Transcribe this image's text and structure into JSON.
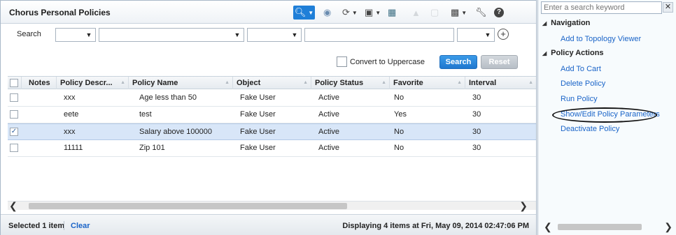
{
  "panel": {
    "title": "Chorus Personal Policies"
  },
  "toolbar": {
    "icons": [
      "search-icon",
      "globe-icon",
      "refresh-icon",
      "save-icon",
      "find-icon",
      "export-icon",
      "settings-wrench-icon",
      "help-icon"
    ]
  },
  "search": {
    "label": "Search",
    "convert_label": "Convert to Uppercase",
    "search_button": "Search",
    "reset_button": "Reset"
  },
  "table": {
    "columns": [
      "Notes",
      "Policy Descr...",
      "Policy Name",
      "Object",
      "Policy Status",
      "Favorite",
      "Interval"
    ],
    "rows": [
      {
        "checked": false,
        "notes": "",
        "descr": "xxx",
        "name": "Age less than 50",
        "object": "Fake User",
        "status": "Active",
        "favorite": "No",
        "interval": "30"
      },
      {
        "checked": false,
        "notes": "",
        "descr": "eete",
        "name": "test",
        "object": "Fake User",
        "status": "Active",
        "favorite": "Yes",
        "interval": "30"
      },
      {
        "checked": true,
        "notes": "",
        "descr": "xxx",
        "name": "Salary above 100000",
        "object": "Fake User",
        "status": "Active",
        "favorite": "No",
        "interval": "30"
      },
      {
        "checked": false,
        "notes": "",
        "descr": "11111",
        "name": "Zip 101",
        "object": "Fake User",
        "status": "Active",
        "favorite": "No",
        "interval": "30"
      }
    ]
  },
  "footer": {
    "selected": "Selected 1 item",
    "clear": "Clear",
    "display": "Displaying 4 items at Fri, May 09, 2014 02:47:06 PM"
  },
  "side": {
    "search_placeholder": "Enter a search keyword",
    "navigation_title": "Navigation",
    "navigation_items": [
      "Add to Topology Viewer"
    ],
    "actions_title": "Policy Actions",
    "action_items": [
      "Add To Cart",
      "Delete Policy",
      "Run Policy",
      "Show/Edit Policy Parameters",
      "Deactivate Policy"
    ]
  },
  "colors": {
    "accent": "#1f7fd8",
    "link": "#1a64c8",
    "selected_row": "#d8e6f8"
  }
}
